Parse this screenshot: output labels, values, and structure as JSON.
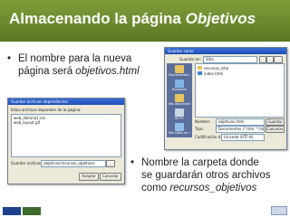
{
  "slide": {
    "title_plain": "Almacenando la página ",
    "title_italic": "Objetivos",
    "bullet1_line1": "El nombre para la nueva",
    "bullet1_line2_plain": "página será ",
    "bullet1_line2_italic": "objetivos.html",
    "bullet2_line1": "Nombre  la carpeta donde",
    "bullet2_line2": "se guardarán otros archivos",
    "bullet2_line3_plain": "como ",
    "bullet2_line3_italic": "recursos_objetivos",
    "bullet_char": "•"
  },
  "save_dialog": {
    "title": "Guardar como",
    "save_in_label": "Guardar en:",
    "folder": "Sitio",
    "files": [
      "recursos_sitio",
      "index.html"
    ],
    "sidebar": [
      "Documentos recientes",
      "Escritorio",
      "Mis documentos",
      "Mi PC",
      "Mis sitios de red"
    ],
    "filename_label": "Nombre:",
    "filename_value": "objetivos.html",
    "filetype_label": "Tipo:",
    "filetype_value": "Documentos (*.htm; *.html; *.shtml)",
    "encoding_label": "Codificación de caracteres:",
    "encoding_value": "Unicode (UTF-8)",
    "save_button": "Guardar",
    "cancel_button": "Cancelar"
  },
  "dep_dialog": {
    "title": "Guardar archivos dependientes",
    "description": "Estos archivos dependen de la página:",
    "files": [
      "web_dollaria1.css",
      "web_layout.gif"
    ],
    "folder_label": "Guardar archivos en:",
    "folder_value": "objetivos/recursos_objetivos",
    "ok_button": "Aceptar",
    "cancel_button": "Cancelar"
  },
  "colors": {
    "title_bar": "#6c8a2e",
    "title_text": "#ffffff",
    "body_text": "#222222",
    "dialog_bg": "#ece9d8",
    "dialog_titlebar": "#2b5cc6"
  }
}
